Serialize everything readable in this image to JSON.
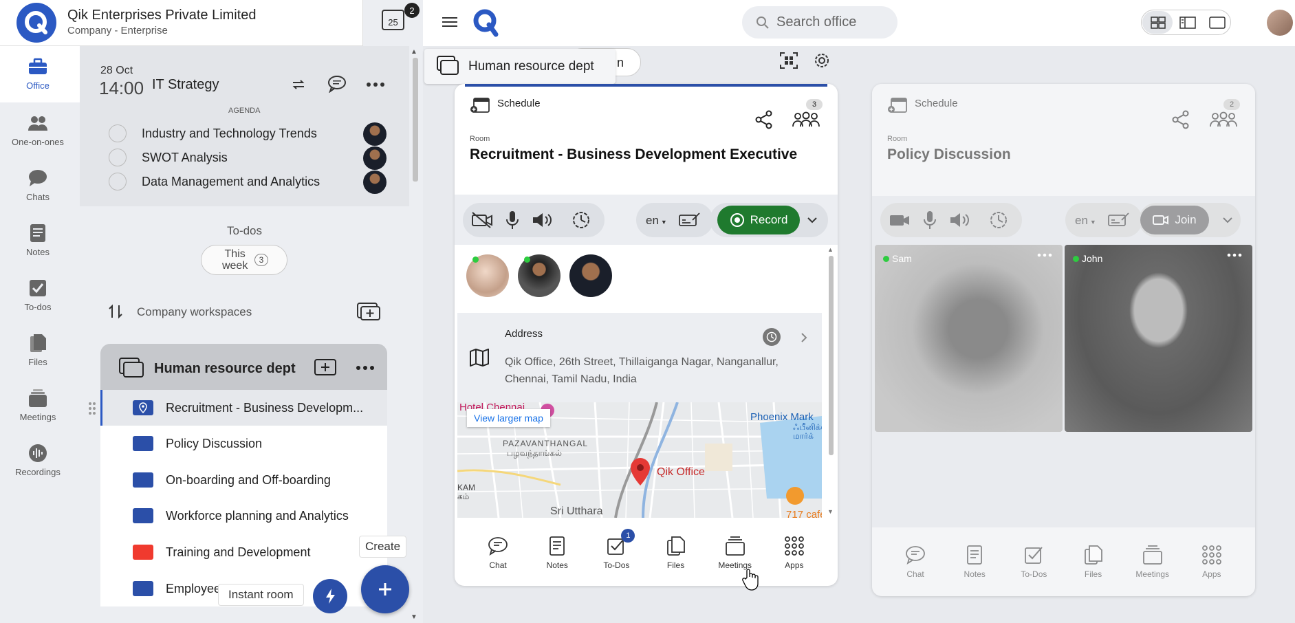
{
  "company": {
    "name": "Qik Enterprises Private Limited",
    "subtitle": "Company - Enterprise",
    "calendar_day": "25",
    "notification_count": "2"
  },
  "nav": [
    {
      "label": "Office",
      "icon": "briefcase-icon"
    },
    {
      "label": "One-on-ones",
      "icon": "people-icon"
    },
    {
      "label": "Chats",
      "icon": "chat-icon"
    },
    {
      "label": "Notes",
      "icon": "notes-icon"
    },
    {
      "label": "To-dos",
      "icon": "checkbox-icon"
    },
    {
      "label": "Files",
      "icon": "files-icon"
    },
    {
      "label": "Meetings",
      "icon": "meetings-icon"
    },
    {
      "label": "Recordings",
      "icon": "recordings-icon"
    }
  ],
  "meeting": {
    "date": "28 Oct",
    "time": "14:00",
    "title": "IT Strategy",
    "agenda_label": "AGENDA",
    "agenda": [
      "Industry and Technology Trends",
      "SWOT Analysis",
      "Data Management and Analytics"
    ]
  },
  "todos": {
    "label": "To-dos",
    "filter": "This week",
    "count": "3"
  },
  "workspaces": {
    "label": "Company workspaces",
    "current": "Human resource dept",
    "rooms": [
      {
        "name": "Recruitment - Business Developm...",
        "color": "#2b4fa8"
      },
      {
        "name": "Policy Discussion",
        "color": "#2b4fa8"
      },
      {
        "name": "On-boarding and Off-boarding",
        "color": "#2b4fa8"
      },
      {
        "name": "Workforce planning and Analytics",
        "color": "#2b4fa8"
      },
      {
        "name": "Training and Development",
        "color": "#f03a2e"
      },
      {
        "name": "Employee",
        "color": "#2b4fa8"
      }
    ]
  },
  "fab": {
    "create": "Create",
    "instant_room": "Instant room"
  },
  "search": {
    "placeholder": "Search office"
  },
  "tab": {
    "title": "Human resource dept",
    "partial": "n"
  },
  "room1": {
    "section": "Schedule",
    "participants": "3",
    "room_label": "Room",
    "title": "Recruitment - Business Development Executive",
    "lang": "en",
    "record": "Record",
    "address_label": "Address",
    "address": "Qik Office, 26th Street, Thillaiganga Nagar, Nanganallur, Chennai, Tamil Nadu, India",
    "map": {
      "view_larger": "View larger map",
      "hotel": "Hotel Chennai",
      "phoenix": "Phoenix Mark",
      "phoenix_ta": "ஃபீனிக்ஸ் மார்க்",
      "pazhavanthangal": "PAZAVANTHANGAL",
      "pazhavanthangal_ta": "பழவந்தாங்கல்",
      "qik": "Qik Office",
      "sri": "Sri Utthara",
      "kam": "KAM",
      "kam_ta": "கம்",
      "cafe": "717 cafe"
    },
    "bottom": [
      {
        "label": "Chat",
        "icon": "chat-icon"
      },
      {
        "label": "Notes",
        "icon": "notes-icon"
      },
      {
        "label": "To-Dos",
        "icon": "todo-icon",
        "badge": "1"
      },
      {
        "label": "Files",
        "icon": "files-icon"
      },
      {
        "label": "Meetings",
        "icon": "meetings-icon"
      },
      {
        "label": "Apps",
        "icon": "apps-icon"
      }
    ]
  },
  "room2": {
    "section": "Schedule",
    "participants": "2",
    "room_label": "Room",
    "title": "Policy Discussion",
    "lang": "en",
    "join": "Join",
    "tiles": [
      {
        "name": "Sam"
      },
      {
        "name": "John"
      }
    ],
    "bottom": [
      {
        "label": "Chat"
      },
      {
        "label": "Notes"
      },
      {
        "label": "To-Dos"
      },
      {
        "label": "Files"
      },
      {
        "label": "Meetings"
      },
      {
        "label": "Apps"
      }
    ]
  }
}
